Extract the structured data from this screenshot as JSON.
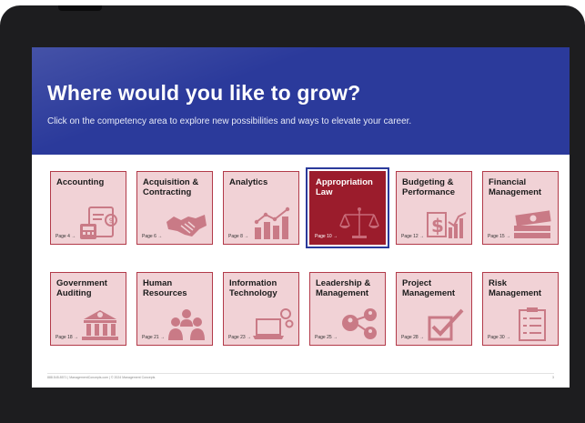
{
  "hero": {
    "title": "Where would you like to grow?",
    "subtitle": "Click on the competency area to explore new possibilities and ways to elevate your career."
  },
  "cards": [
    {
      "label": "Accounting",
      "page": "Page 4 →",
      "icon": "calculator-invoice-icon",
      "active": false
    },
    {
      "label": "Acquisition & Contracting",
      "page": "Page 6 →",
      "icon": "handshake-icon",
      "active": false
    },
    {
      "label": "Analytics",
      "page": "Page 8 →",
      "icon": "bar-line-chart-icon",
      "active": false
    },
    {
      "label": "Appropriation Law",
      "page": "Page 10 →",
      "icon": "scales-of-justice-icon",
      "active": true
    },
    {
      "label": "Budgeting & Performance",
      "page": "Page 12 →",
      "icon": "dollar-chart-icon",
      "active": false
    },
    {
      "label": "Financial Management",
      "page": "Page 15 →",
      "icon": "money-stack-icon",
      "active": false
    },
    {
      "label": "Government Auditing",
      "page": "Page 18 →",
      "icon": "government-building-icon",
      "active": false
    },
    {
      "label": "Human Resources",
      "page": "Page 21 →",
      "icon": "people-group-icon",
      "active": false
    },
    {
      "label": "Information Technology",
      "page": "Page 23 →",
      "icon": "laptop-gears-icon",
      "active": false
    },
    {
      "label": "Leadership & Management",
      "page": "Page 25 →",
      "icon": "connected-people-icon",
      "active": false
    },
    {
      "label": "Project Management",
      "page": "Page 28 →",
      "icon": "checkmark-box-icon",
      "active": false
    },
    {
      "label": "Risk Management",
      "page": "Page 30 →",
      "icon": "checklist-clipboard-icon",
      "active": false
    }
  ],
  "footer": {
    "text": "888.545.8571 | ManagementConcepts.com | © 2024 Management Concepts",
    "page": "3"
  },
  "colors": {
    "hero": "#2b3a9b",
    "card_bg": "#f1d2d6",
    "card_border": "#b23a49",
    "card_active": "#9b1c2c",
    "icon": "#c97a86"
  }
}
